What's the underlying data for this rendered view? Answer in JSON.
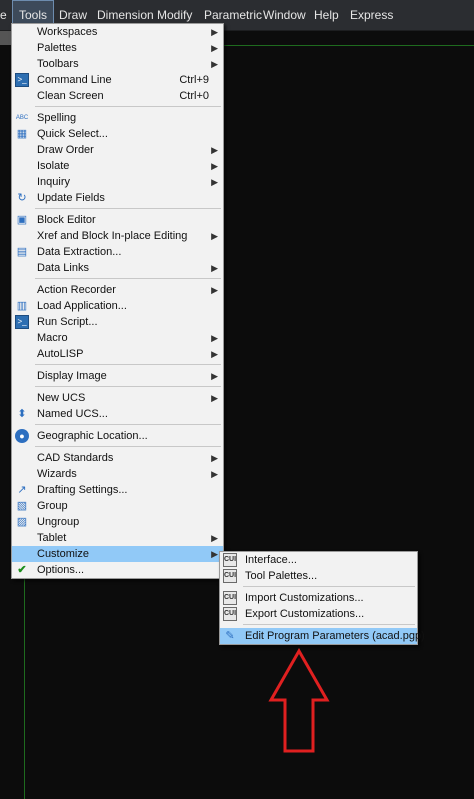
{
  "menubar": {
    "items": [
      {
        "label": "e"
      },
      {
        "label": "Tools"
      },
      {
        "label": "Draw"
      },
      {
        "label": "Dimension"
      },
      {
        "label": "Modify"
      },
      {
        "label": "Parametric"
      },
      {
        "label": "Window"
      },
      {
        "label": "Help"
      },
      {
        "label": "Express"
      }
    ],
    "active_index": 1
  },
  "tools_menu": {
    "items": [
      {
        "label": "Workspaces",
        "submenu": true
      },
      {
        "label": "Palettes",
        "submenu": true
      },
      {
        "label": "Toolbars",
        "submenu": true
      },
      {
        "label": "Command Line",
        "shortcut": "Ctrl+9",
        "icon": "command-line-icon"
      },
      {
        "label": "Clean Screen",
        "shortcut": "Ctrl+0"
      },
      {
        "separator": true
      },
      {
        "label": "Spelling",
        "icon": "spelling-icon"
      },
      {
        "label": "Quick Select...",
        "icon": "quick-select-icon"
      },
      {
        "label": "Draw Order",
        "submenu": true
      },
      {
        "label": "Isolate",
        "submenu": true
      },
      {
        "label": "Inquiry",
        "submenu": true
      },
      {
        "label": "Update Fields",
        "icon": "update-fields-icon"
      },
      {
        "separator": true
      },
      {
        "label": "Block Editor",
        "icon": "block-editor-icon"
      },
      {
        "label": "Xref and Block In-place Editing",
        "submenu": true
      },
      {
        "label": "Data Extraction...",
        "icon": "data-extraction-icon"
      },
      {
        "label": "Data Links",
        "submenu": true
      },
      {
        "separator": true
      },
      {
        "label": "Action Recorder",
        "submenu": true
      },
      {
        "label": "Load Application...",
        "icon": "load-application-icon"
      },
      {
        "label": "Run Script...",
        "icon": "run-script-icon"
      },
      {
        "label": "Macro",
        "submenu": true
      },
      {
        "label": "AutoLISP",
        "submenu": true
      },
      {
        "separator": true
      },
      {
        "label": "Display Image",
        "submenu": true
      },
      {
        "separator": true
      },
      {
        "label": "New UCS",
        "submenu": true
      },
      {
        "label": "Named UCS...",
        "icon": "named-ucs-icon"
      },
      {
        "separator": true
      },
      {
        "label": "Geographic Location...",
        "icon": "globe-icon"
      },
      {
        "separator": true
      },
      {
        "label": "CAD Standards",
        "submenu": true
      },
      {
        "label": "Wizards",
        "submenu": true
      },
      {
        "label": "Drafting Settings...",
        "icon": "drafting-settings-icon"
      },
      {
        "label": "Group",
        "icon": "group-icon"
      },
      {
        "label": "Ungroup",
        "icon": "ungroup-icon"
      },
      {
        "label": "Tablet",
        "submenu": true
      },
      {
        "label": "Customize",
        "submenu": true,
        "highlighted": true
      },
      {
        "label": "Options...",
        "icon": "options-check-icon"
      }
    ]
  },
  "customize_menu": {
    "items": [
      {
        "label": "Interface...",
        "icon": "cui-icon"
      },
      {
        "label": "Tool Palettes...",
        "icon": "tool-palettes-icon"
      },
      {
        "separator": true
      },
      {
        "label": "Import Customizations...",
        "icon": "import-cui-icon"
      },
      {
        "label": "Export Customizations...",
        "icon": "export-cui-icon"
      },
      {
        "separator": true
      },
      {
        "label": "Edit Program Parameters (acad.pgp)",
        "icon": "edit-pgp-icon",
        "highlighted": true
      }
    ]
  },
  "icon_glyphs": {
    "spelling-icon": "ABC",
    "cui-icon": "CUI",
    "tool-palettes-icon": "CUI",
    "import-cui-icon": "CUI",
    "export-cui-icon": "CUI"
  },
  "colors": {
    "highlight": "#91c9f7",
    "menubar_bg": "#2b2d31",
    "annotation_arrow": "#e02020"
  }
}
